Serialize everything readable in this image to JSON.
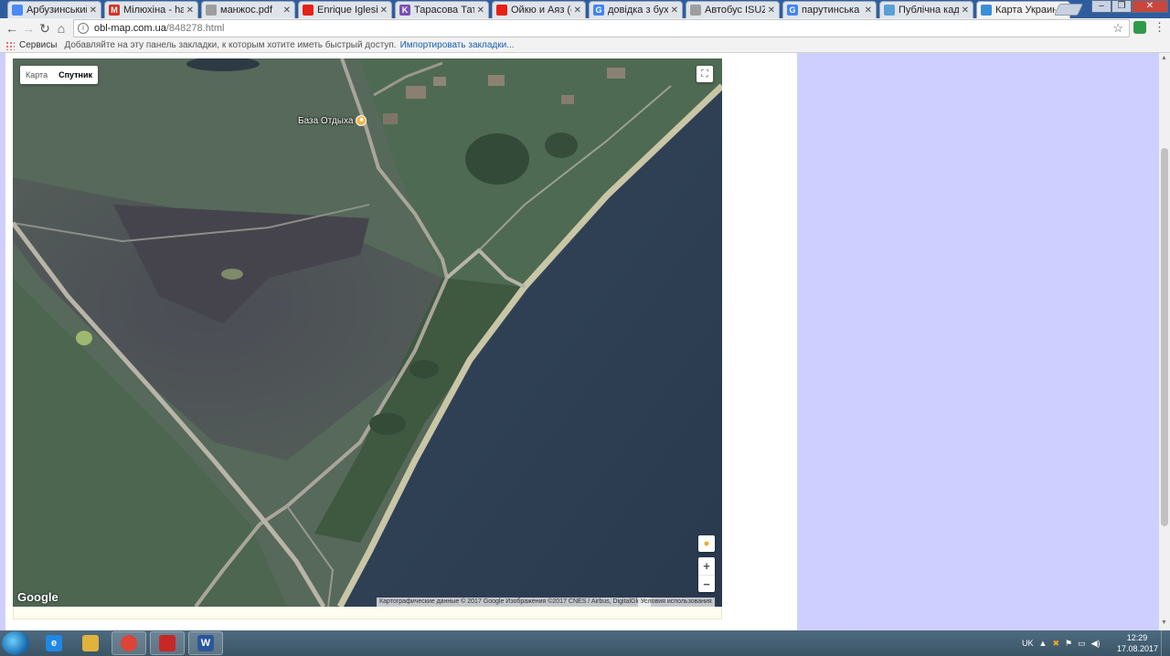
{
  "browser": {
    "tabs": [
      {
        "title": "Арбузинський ра",
        "favicon": "maps-icon",
        "favicon_color": "#4a8af4",
        "favicon_text": "",
        "active": false
      },
      {
        "title": "Мілюхіна - hamr",
        "favicon": "gmail-icon",
        "favicon_color": "#d93025",
        "favicon_text": "M",
        "active": false
      },
      {
        "title": "манжос.pdf",
        "favicon": "document-icon",
        "favicon_color": "#9e9e9e",
        "favicon_text": "",
        "active": false
      },
      {
        "title": "Enrique Iglesias",
        "favicon": "youtube-icon",
        "favicon_color": "#e62117",
        "favicon_text": "",
        "active": false
      },
      {
        "title": "Тарасова Татьяна",
        "favicon": "k-icon",
        "favicon_color": "#7b4fb3",
        "favicon_text": "K",
        "active": false
      },
      {
        "title": "Ойкю и Аяз (сер",
        "favicon": "youtube-icon",
        "favicon_color": "#e62117",
        "favicon_text": "",
        "active": false
      },
      {
        "title": "довідка з бухгал",
        "favicon": "google-icon",
        "favicon_color": "#4285f4",
        "favicon_text": "G",
        "active": false
      },
      {
        "title": "Автобус ISUZU М",
        "favicon": "document-icon",
        "favicon_color": "#9e9e9e",
        "favicon_text": "",
        "active": false
      },
      {
        "title": "парутинська с/р",
        "favicon": "google-icon",
        "favicon_color": "#4285f4",
        "favicon_text": "G",
        "active": false
      },
      {
        "title": "Публічна кадастр",
        "favicon": "cadastre-icon",
        "favicon_color": "#5aa0d6",
        "favicon_text": "",
        "active": false
      },
      {
        "title": "Карта Украины о",
        "favicon": "globe-icon",
        "favicon_color": "#3a8fd6",
        "favicon_text": "",
        "active": true
      }
    ],
    "tab_close_glyph": "✕",
    "url_host": "obl-map.com.ua",
    "url_path": "/848278.html",
    "bookmarks": {
      "services_label": "Сервисы",
      "prompt": "Добавляйте на эту панель закладки, к которым хотите иметь быстрый доступ.",
      "import_link": "Импортировать закладки..."
    }
  },
  "map": {
    "type_buttons": [
      {
        "label": "Карта",
        "selected": false
      },
      {
        "label": "Спутник",
        "selected": true
      }
    ],
    "poi_label": "База Отдыха",
    "google_logo": "Google",
    "attribution": "Картографические данные © 2017 Google Изображения ©2017 CNES / Airbus, DigitalGlobe",
    "terms": "Условия использования",
    "zoom_in": "+",
    "zoom_out": "−"
  },
  "taskbar": {
    "apps": [
      {
        "name": "ie",
        "color": "#1e88e5",
        "text": "e",
        "running": false
      },
      {
        "name": "explorer",
        "color": "#e0b33b",
        "text": "",
        "running": false
      },
      {
        "name": "chrome",
        "color": "#db4437",
        "text": "",
        "running": true
      },
      {
        "name": "acrobat",
        "color": "#c62828",
        "text": "",
        "running": true
      },
      {
        "name": "word",
        "color": "#2b579a",
        "text": "W",
        "running": true
      }
    ],
    "language": "UK",
    "time": "12:29",
    "date": "17.08.2017"
  }
}
